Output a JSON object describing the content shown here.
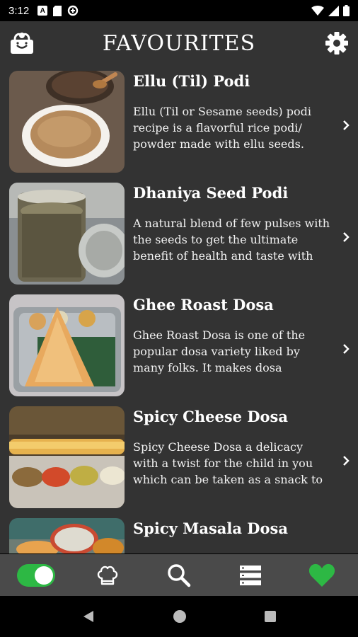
{
  "status_bar": {
    "time": "3:12",
    "badge_a": "A"
  },
  "app_bar": {
    "title": "FAVOURITES"
  },
  "recipes": [
    {
      "title": "Ellu (Til) Podi",
      "description": "Ellu (Til or Sesame seeds) podi recipe is a flavorful rice podi/ powder made with ellu seeds."
    },
    {
      "title": "Dhaniya Seed Podi",
      "description": "A natural blend of few pulses with the seeds to get the ultimate benefit of health and taste with"
    },
    {
      "title": "Ghee Roast Dosa",
      "description": "Ghee Roast Dosa is one of the popular dosa variety liked by many folks. It makes dosa"
    },
    {
      "title": "Spicy Cheese Dosa",
      "description": "Spicy Cheese Dosa a delicacy with a twist for the child in you which can be taken as a snack to"
    },
    {
      "title": "Spicy Masala Dosa",
      "description": ""
    }
  ],
  "bottom_nav": {
    "items": [
      "toggle",
      "chef-hat-icon",
      "search-icon",
      "list-icon",
      "heart-icon"
    ],
    "accent": "#2db844"
  },
  "colors": {
    "background": "#333333",
    "nav": "#4a4a4a",
    "accent": "#2db844"
  }
}
